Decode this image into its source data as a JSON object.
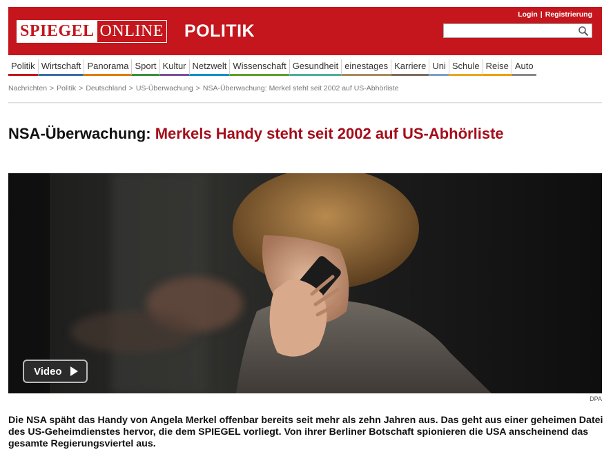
{
  "header": {
    "login_label": "Login",
    "separator": "|",
    "register_label": "Registrierung",
    "logo_part1": "SPIEGEL",
    "logo_part2": "ONLINE",
    "section_title": "POLITIK",
    "search_value": "",
    "brand_color": "#c4161c"
  },
  "nav": {
    "items": [
      {
        "label": "Politik",
        "color": "#c4161c"
      },
      {
        "label": "Wirtschaft",
        "color": "#3a6ea5"
      },
      {
        "label": "Panorama",
        "color": "#e07b00"
      },
      {
        "label": "Sport",
        "color": "#3b8f3b"
      },
      {
        "label": "Kultur",
        "color": "#7b4e9c"
      },
      {
        "label": "Netzwelt",
        "color": "#0091c9"
      },
      {
        "label": "Wissenschaft",
        "color": "#5aa02c"
      },
      {
        "label": "Gesundheit",
        "color": "#4cae9b"
      },
      {
        "label": "einestages",
        "color": "#a58a5a"
      },
      {
        "label": "Karriere",
        "color": "#7d6b5d"
      },
      {
        "label": "Uni",
        "color": "#7a9fc9"
      },
      {
        "label": "Schule",
        "color": "#e7a71e"
      },
      {
        "label": "Reise",
        "color": "#f29d00"
      },
      {
        "label": "Auto",
        "color": "#888888"
      }
    ]
  },
  "breadcrumb": {
    "items": [
      "Nachrichten",
      "Politik",
      "Deutschland",
      "US-Überwachung",
      "NSA-Überwachung: Merkel steht seit 2002 auf US-Abhörliste"
    ],
    "separator": ">"
  },
  "article": {
    "kicker": "NSA-Überwachung:",
    "headline": "Merkels Handy steht seit 2002 auf US-Abhörliste",
    "video_label": "Video",
    "photo_credit": "DPA",
    "lead": "Die NSA späht das Handy von Angela Merkel offenbar bereits seit mehr als zehn Jahren aus. Das geht aus einer geheimen Datei des US-Geheimdienstes hervor, die dem SPIEGEL vorliegt. Von ihrer Berliner Botschaft spionieren die USA anscheinend das gesamte Regierungsviertel aus.",
    "headline_color": "#a50d1a"
  }
}
